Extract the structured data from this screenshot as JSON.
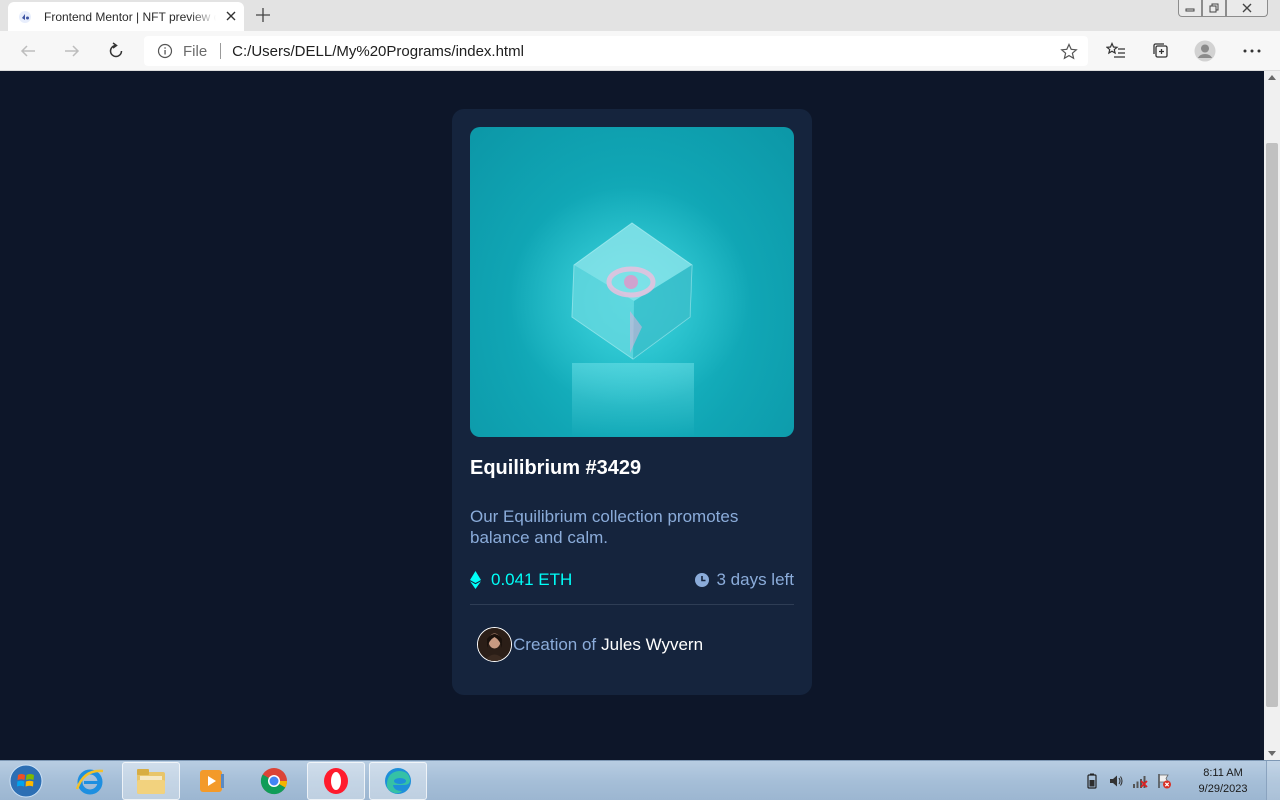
{
  "browser": {
    "tab_title": "Frontend Mentor | NFT preview card component",
    "address_scheme": "File",
    "address_url": "C:/Users/DELL/My%20Programs/index.html"
  },
  "card": {
    "title": "Equilibrium #3429",
    "description": "Our Equilibrium collection promotes balance and calm.",
    "price": "0.041 ETH",
    "time_left": "3 days left",
    "creator_prefix": "Creation of",
    "creator_name": "Jules Wyvern"
  },
  "taskbar": {
    "time": "8:11 AM",
    "date": "9/29/2023"
  },
  "colors": {
    "page_background": "#0d1629",
    "card_background": "#15243d",
    "accent_cyan": "#00fff8",
    "soft_blue": "#8bacda"
  }
}
